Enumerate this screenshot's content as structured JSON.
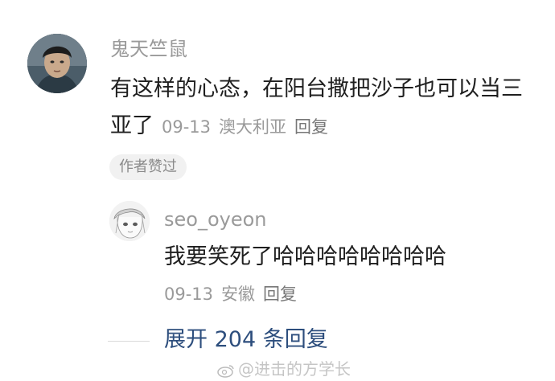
{
  "comment": {
    "username": "鬼天竺鼠",
    "text": "有这样的心态，在阳台撒把沙子也可以当三亚了",
    "date": "09-13",
    "location": "澳大利亚",
    "reply_label": "回复",
    "liked_badge": "作者赞过",
    "avatar_icon": "person-avatar-photo"
  },
  "reply": {
    "username": "seo_oyeon",
    "text": "我要笑死了哈哈哈哈哈哈哈哈",
    "date": "09-13",
    "location": "安徽",
    "reply_label": "回复",
    "avatar_icon": "anime-sketch-avatar"
  },
  "expand_replies": {
    "label": "展开 204 条回复"
  },
  "watermark": {
    "text": "@进击的方学长"
  },
  "colors": {
    "username": "#9a9a9a",
    "body_text": "#1f1f1f",
    "link_blue": "#2d4e7d",
    "badge_bg": "#f1f1f1"
  }
}
